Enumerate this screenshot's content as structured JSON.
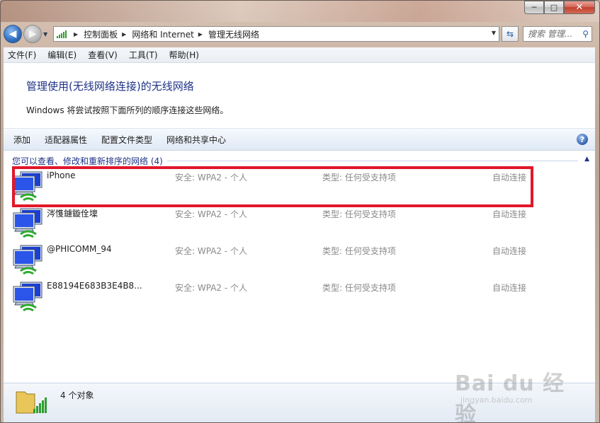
{
  "window": {
    "minimize": "─",
    "maximize": "□",
    "close": "✕"
  },
  "address": {
    "crumbs": [
      "控制面板",
      "网络和 Internet",
      "管理无线网络"
    ]
  },
  "search": {
    "placeholder": "搜索 管理..."
  },
  "menu": [
    "文件(F)",
    "编辑(E)",
    "查看(V)",
    "工具(T)",
    "帮助(H)"
  ],
  "page": {
    "heading": "管理使用(无线网络连接)的无线网络",
    "subtext": "Windows 将尝试按照下面所列的顺序连接这些网络。"
  },
  "commands": [
    "添加",
    "适配器属性",
    "配置文件类型",
    "网络和共享中心"
  ],
  "help_label": "?",
  "group": {
    "label": "您可以查看、修改和重新排序的网络 (4)"
  },
  "networks": [
    {
      "name": "iPhone",
      "security": "安全: WPA2 - 个人",
      "type": "类型: 任何受支持项",
      "mode": "自动连接"
    },
    {
      "name": "涔愯鐪鏇佺壈",
      "security": "安全: WPA2 - 个人",
      "type": "类型: 任何受支持项",
      "mode": "自动连接"
    },
    {
      "name": "@PHICOMM_94",
      "security": "安全: WPA2 - 个人",
      "type": "类型: 任何受支持项",
      "mode": "自动连接"
    },
    {
      "name": "E88194E683B3E4B8...",
      "security": "安全: WPA2 - 个人",
      "type": "类型: 任何受支持项",
      "mode": "自动连接"
    }
  ],
  "status": {
    "count": "4 个对象"
  },
  "watermark": {
    "main": "Bai du 经验",
    "sub": "jingyan.baidu.com"
  },
  "colors": {
    "highlight": "#e2172a",
    "heading": "#1e3287"
  }
}
